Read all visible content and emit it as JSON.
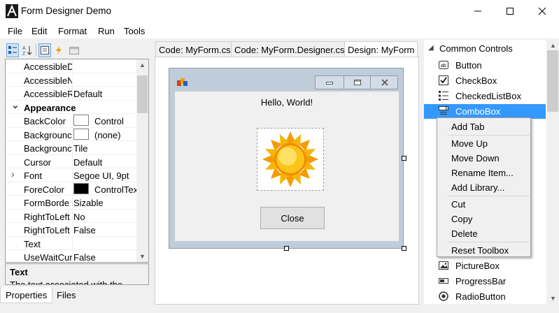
{
  "window": {
    "title": "Form Designer Demo"
  },
  "menu": [
    "File",
    "Edit",
    "Format",
    "Run",
    "Tools"
  ],
  "property_grid": {
    "rows": [
      {
        "name": "AccessibleD",
        "value": ""
      },
      {
        "name": "AccessibleN",
        "value": ""
      },
      {
        "name": "AccessibleR",
        "value": "Default"
      },
      {
        "name": "Appearance",
        "value": "",
        "category": true
      },
      {
        "name": "BackColor",
        "value": "Control",
        "swatch": "#ffffff"
      },
      {
        "name": "Backgrounc",
        "value": "(none)",
        "swatch": "#ffffff"
      },
      {
        "name": "Backgrounc",
        "value": "Tile"
      },
      {
        "name": "Cursor",
        "value": "Default"
      },
      {
        "name": "Font",
        "value": "Segoe UI, 9pt",
        "expandable": true
      },
      {
        "name": "ForeColor",
        "value": "ControlTex",
        "swatch": "#000000"
      },
      {
        "name": "FormBorde",
        "value": "Sizable"
      },
      {
        "name": "RightToLeft",
        "value": "No"
      },
      {
        "name": "RightToLeft",
        "value": "False"
      },
      {
        "name": "Text",
        "value": ""
      },
      {
        "name": "UseWaitCur",
        "value": "False"
      }
    ],
    "description_title": "Text",
    "description_text": "The text associated with the"
  },
  "left_tabs": [
    "Properties",
    "Files"
  ],
  "doc_tabs": [
    "Code: MyForm.cs",
    "Code: MyForm.Designer.cs",
    "Design: MyForm"
  ],
  "form": {
    "label": "Hello, World!",
    "button": "Close"
  },
  "toolbox": {
    "group": "Common Controls",
    "items_top": [
      {
        "label": "Button",
        "icon": "button-icon"
      },
      {
        "label": "CheckBox",
        "icon": "checkbox-icon"
      },
      {
        "label": "CheckedListBox",
        "icon": "checkedlistbox-icon"
      },
      {
        "label": "ComboBox",
        "icon": "combobox-icon",
        "selected": true
      }
    ],
    "items_bottom": [
      {
        "label": "PictureBox",
        "icon": "picturebox-icon"
      },
      {
        "label": "ProgressBar",
        "icon": "progressbar-icon"
      },
      {
        "label": "RadioButton",
        "icon": "radiobutton-icon"
      }
    ]
  },
  "context_menu": {
    "groups": [
      [
        "Add Tab"
      ],
      [
        "Move Up",
        "Move Down",
        "Rename Item...",
        "Add Library..."
      ],
      [
        "Cut",
        "Copy",
        "Delete"
      ],
      [
        "Reset Toolbox"
      ]
    ]
  },
  "colors": {
    "selection": "#3399ff",
    "accent": "#0078d7"
  }
}
